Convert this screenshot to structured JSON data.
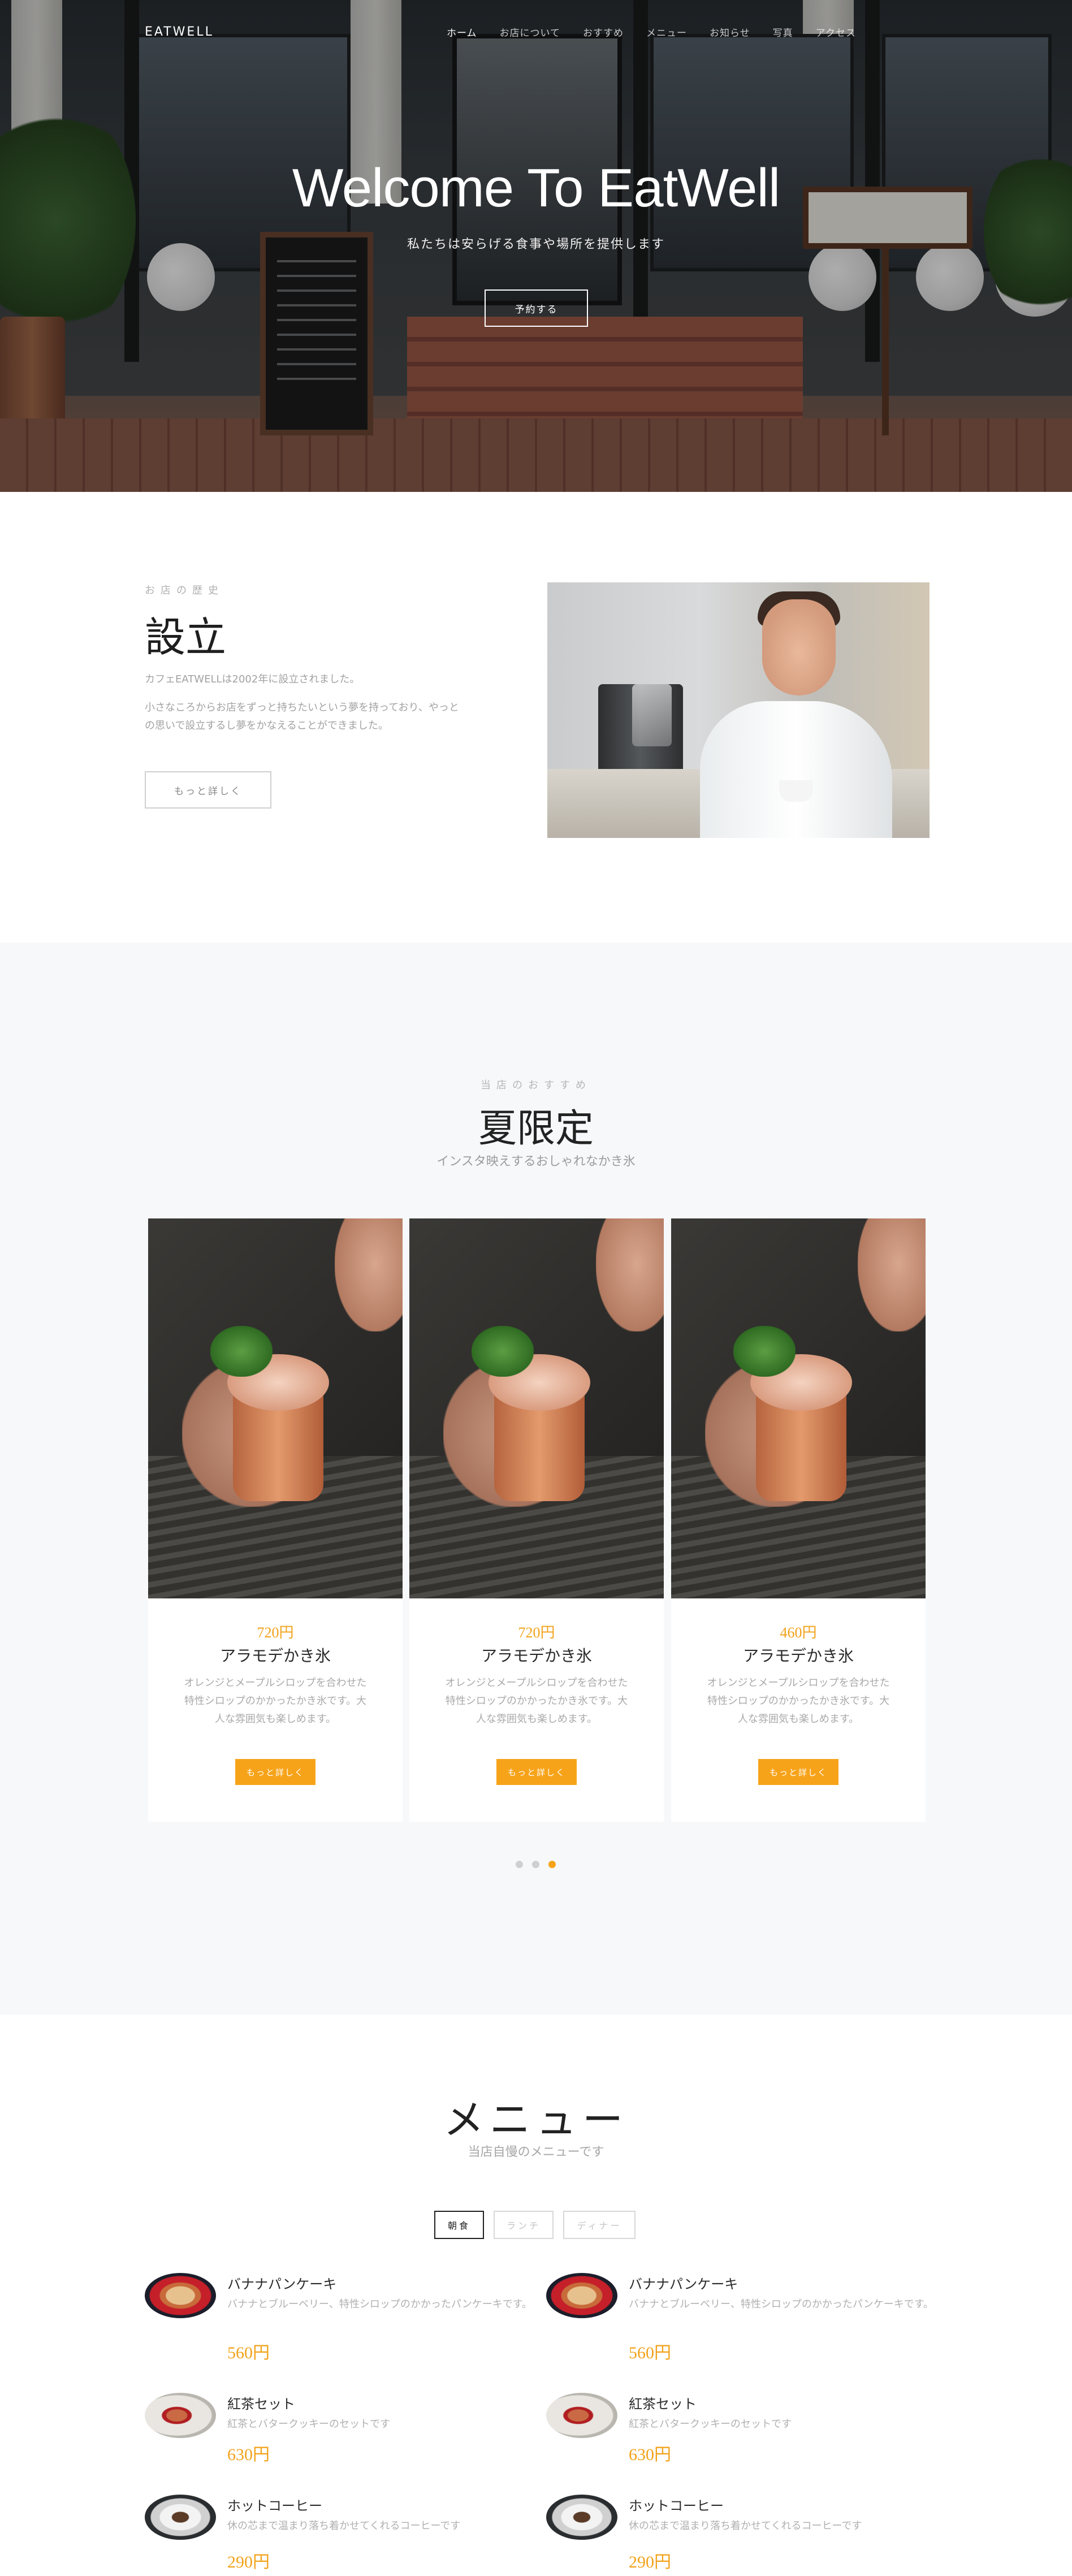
{
  "nav": {
    "brand": "EATWELL",
    "items": [
      {
        "label": "ホーム",
        "active": true
      },
      {
        "label": "お店について"
      },
      {
        "label": "おすすめ"
      },
      {
        "label": "メニュー"
      },
      {
        "label": "お知らせ"
      },
      {
        "label": "写真"
      },
      {
        "label": "アクセス"
      }
    ]
  },
  "hero": {
    "title": "Welcome To EatWell",
    "subtitle": "私たちは安らげる食事や場所を提供します",
    "button": "予約する"
  },
  "about": {
    "kicker": "お店の歴史",
    "title": "設立",
    "p1": "カフェEATWELLは2002年に設立されました。",
    "p2": "小さなころからお店をずっと持ちたいという夢を持っており、やっとの思いで設立するし夢をかなえることができました。",
    "button": "もっと詳しく"
  },
  "specials": {
    "kicker": "当店のおすすめ",
    "title": "夏限定",
    "subtitle": "インスタ映えするおしゃれなかき氷",
    "cards": [
      {
        "price": "720円",
        "name": "アラモデかき氷",
        "desc": "オレンジとメープルシロップを合わせた特性シロップのかかったかき氷です。大人な雰囲気も楽しめます。",
        "button": "もっと詳しく"
      },
      {
        "price": "720円",
        "name": "アラモデかき氷",
        "desc": "オレンジとメープルシロップを合わせた特性シロップのかかったかき氷です。大人な雰囲気も楽しめます。",
        "button": "もっと詳しく"
      },
      {
        "price": "460円",
        "name": "アラモデかき氷",
        "desc": "オレンジとメープルシロップを合わせた特性シロップのかかったかき氷です。大人な雰囲気も楽しめます。",
        "button": "もっと詳しく"
      }
    ],
    "active_dot": 3,
    "dot_count": 3
  },
  "menu": {
    "title": "メニュー",
    "subtitle": "当店自慢のメニューです",
    "tabs": [
      {
        "label": "朝食",
        "active": true
      },
      {
        "label": "ランチ"
      },
      {
        "label": "ディナー"
      }
    ],
    "items": [
      {
        "name": "バナナパンケーキ",
        "desc": "バナナとブルーベリー、特性シロップのかかったパンケーキです。",
        "price": "560円",
        "icon": "pancake"
      },
      {
        "name": "バナナパンケーキ",
        "desc": "バナナとブルーベリー、特性シロップのかかったパンケーキです。",
        "price": "560円",
        "icon": "pancake"
      },
      {
        "name": "紅茶セット",
        "desc": "紅茶とバタークッキーのセットです",
        "price": "630円",
        "icon": "tea"
      },
      {
        "name": "紅茶セット",
        "desc": "紅茶とバタークッキーのセットです",
        "price": "630円",
        "icon": "tea"
      },
      {
        "name": "ホットコーヒー",
        "desc": "休の芯まで温まり落ち着かせてくれるコーヒーです",
        "price": "290円",
        "icon": "coffee"
      },
      {
        "name": "ホットコーヒー",
        "desc": "休の芯まで温まり落ち着かせてくれるコーヒーです",
        "price": "290円",
        "icon": "coffee"
      }
    ]
  },
  "colors": {
    "accent": "#f7a31a",
    "section_bg": "#f6f8fa",
    "muted_text": "#a9a9a9"
  }
}
